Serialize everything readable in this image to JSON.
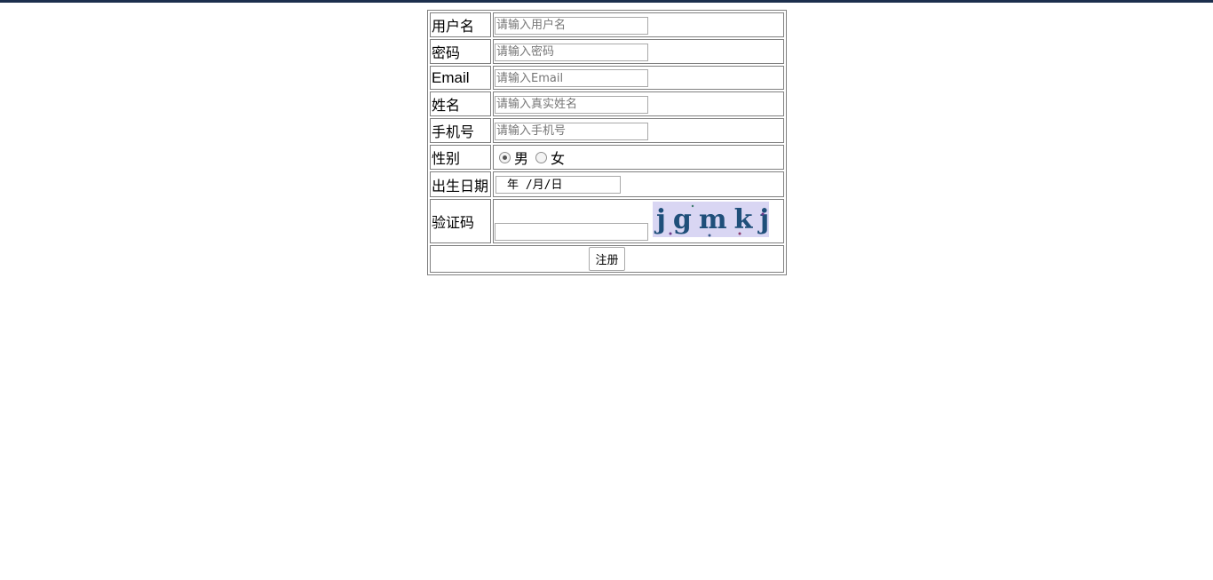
{
  "form": {
    "fields": [
      {
        "label": "用户名",
        "placeholder": "请输入用户名"
      },
      {
        "label": "密码",
        "placeholder": "请输入密码"
      },
      {
        "label": "Email",
        "placeholder": "请输入Email"
      },
      {
        "label": "姓名",
        "placeholder": "请输入真实姓名"
      },
      {
        "label": "手机号",
        "placeholder": "请输入手机号"
      }
    ],
    "gender": {
      "label": "性别",
      "options": [
        "男",
        "女"
      ],
      "selected": "男"
    },
    "birthday": {
      "label": "出生日期",
      "display": "年 /月/日"
    },
    "captcha": {
      "label": "验证码",
      "value": "",
      "image_text": "jgmkj"
    },
    "submit_label": "注册"
  },
  "colors": {
    "topbar": "#1c2f4d",
    "border": "#808080",
    "captcha_bg": "#d9d6f3"
  }
}
